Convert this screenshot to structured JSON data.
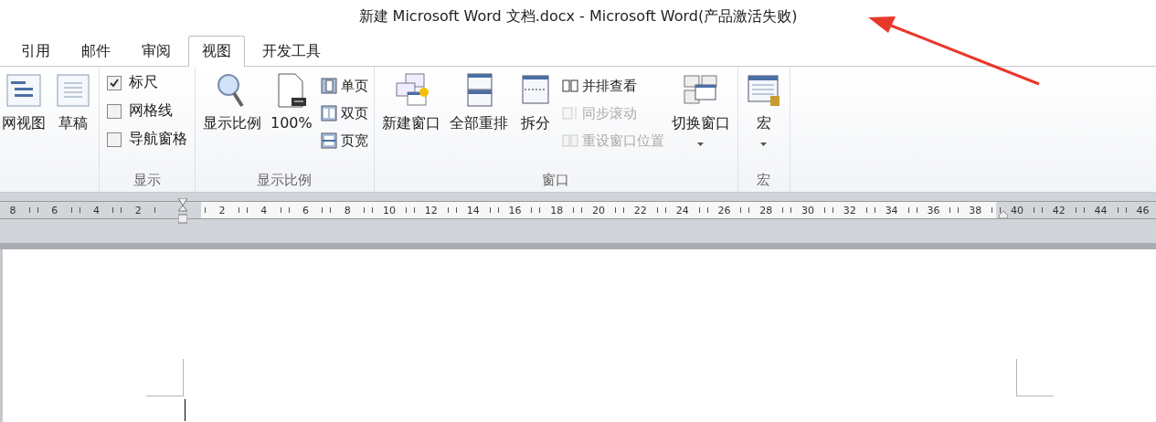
{
  "window": {
    "title": "新建 Microsoft Word 文档.docx - Microsoft Word(产品激活失败)"
  },
  "tabs": [
    {
      "label": "引用",
      "selected": false
    },
    {
      "label": "邮件",
      "selected": false
    },
    {
      "label": "审阅",
      "selected": false
    },
    {
      "label": "视图",
      "selected": true
    },
    {
      "label": "开发工具",
      "selected": false
    }
  ],
  "ribbon": {
    "groups": [
      {
        "items": [
          {
            "kind": "large",
            "label": "网视图",
            "disabled": false
          },
          {
            "kind": "large",
            "label": "草稿",
            "disabled": false
          }
        ]
      },
      {
        "label": "显示",
        "items": [
          {
            "kind": "checkbox",
            "label": "标尺",
            "checked": true
          },
          {
            "kind": "checkbox",
            "label": "网格线",
            "checked": false
          },
          {
            "kind": "checkbox",
            "label": "导航窗格",
            "checked": false
          }
        ]
      },
      {
        "label": "显示比例",
        "items": [
          {
            "kind": "large",
            "label": "显示比例",
            "disabled": false
          },
          {
            "kind": "large",
            "label": "100%",
            "disabled": false
          },
          {
            "kind": "small_stack",
            "items": [
              {
                "label": "单页",
                "disabled": false
              },
              {
                "label": "双页",
                "disabled": false
              },
              {
                "label": "页宽",
                "disabled": false
              }
            ]
          }
        ]
      },
      {
        "label": "窗口",
        "items": [
          {
            "kind": "large",
            "label": "新建窗口",
            "disabled": false
          },
          {
            "kind": "large",
            "label": "全部重排",
            "disabled": false
          },
          {
            "kind": "large",
            "label": "拆分",
            "disabled": false
          },
          {
            "kind": "small_stack",
            "items": [
              {
                "label": "并排查看",
                "disabled": false
              },
              {
                "label": "同步滚动",
                "disabled": true
              },
              {
                "label": "重设窗口位置",
                "disabled": true
              }
            ]
          },
          {
            "kind": "dropdown",
            "label": "切换窗口",
            "disabled": false
          }
        ]
      },
      {
        "label": "宏",
        "items": [
          {
            "kind": "dropdown",
            "label": "宏",
            "disabled": false
          }
        ]
      }
    ]
  },
  "ruler": {
    "left_labels": [
      "8",
      "6",
      "4",
      "2"
    ],
    "labels": [
      "2",
      "4",
      "6",
      "8",
      "10",
      "12",
      "14",
      "16",
      "18",
      "20",
      "22",
      "24",
      "26",
      "28",
      "30",
      "32",
      "34",
      "36",
      "38"
    ],
    "right_labels": [
      "40",
      "42",
      "44",
      "46"
    ]
  }
}
